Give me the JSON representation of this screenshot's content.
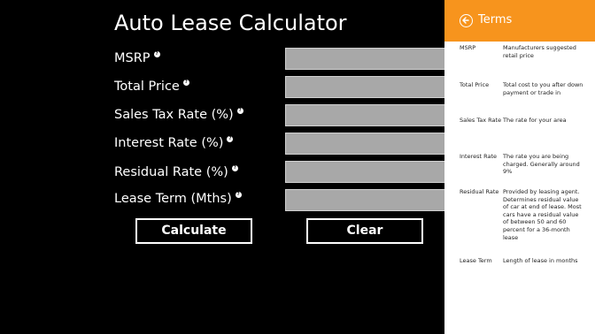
{
  "app": {
    "title": "Auto Lease Calculator"
  },
  "fields": [
    {
      "label": "MSRP",
      "value": "",
      "help": "?"
    },
    {
      "label": "Total Price",
      "value": "",
      "help": "?"
    },
    {
      "label": "Sales Tax Rate (%)",
      "value": "",
      "help": "?"
    },
    {
      "label": "Interest Rate (%)",
      "value": "",
      "help": "?"
    },
    {
      "label": "Residual Rate (%)",
      "value": "",
      "help": "?"
    },
    {
      "label": "Lease Term (Mths)",
      "value": "",
      "help": "?"
    }
  ],
  "buttons": {
    "calculate": "Calculate",
    "clear": "Clear"
  },
  "panel": {
    "title": "Terms",
    "accent": "#f7941d",
    "back_icon": "back-arrow-circle-icon",
    "terms": [
      {
        "term": "MSRP",
        "definition": "Manufacturers suggested retail price"
      },
      {
        "term": "Total Price",
        "definition": "Total cost to you after down payment or trade in"
      },
      {
        "term": "Sales Tax Rate",
        "definition": "The rate for your area"
      },
      {
        "term": "Interest Rate",
        "definition": "The rate you are being charged. Generally around 9%"
      },
      {
        "term": "Residual Rate",
        "definition": "Provided by leasing agent. Determines residual value of car at end of lease. Most cars have a residual value of between 50 and 60 percent for a 36-month lease"
      },
      {
        "term": "Lease Term",
        "definition": "Length of lease in months"
      }
    ]
  }
}
